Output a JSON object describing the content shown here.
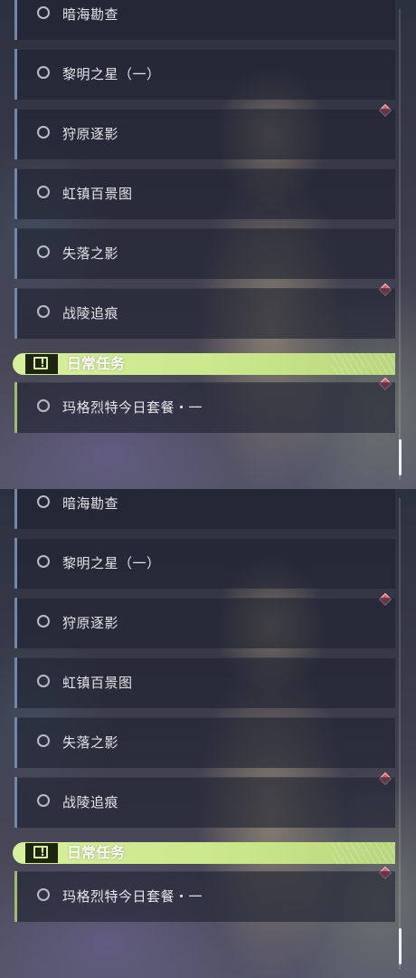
{
  "quest_list": {
    "quests": [
      {
        "title": "暗海勘查",
        "marker": false
      },
      {
        "title": "黎明之星（一）",
        "marker": true
      },
      {
        "title": "狩原逐影",
        "marker": false
      },
      {
        "title": "虹镇百景图",
        "marker": false
      },
      {
        "title": "失落之影",
        "marker": true
      },
      {
        "title": "战陵追痕",
        "marker": false
      }
    ],
    "category": {
      "title": "日常任务",
      "icon": "exclamation-box-icon"
    },
    "daily_quests": [
      {
        "title": "玛格烈特今日套餐・一",
        "marker": true
      }
    ]
  },
  "colors": {
    "category_accent": "#d6f09a",
    "quest_border": "#6f8aa8",
    "daily_border": "#9bbf6a",
    "marker": "#e0566a"
  }
}
